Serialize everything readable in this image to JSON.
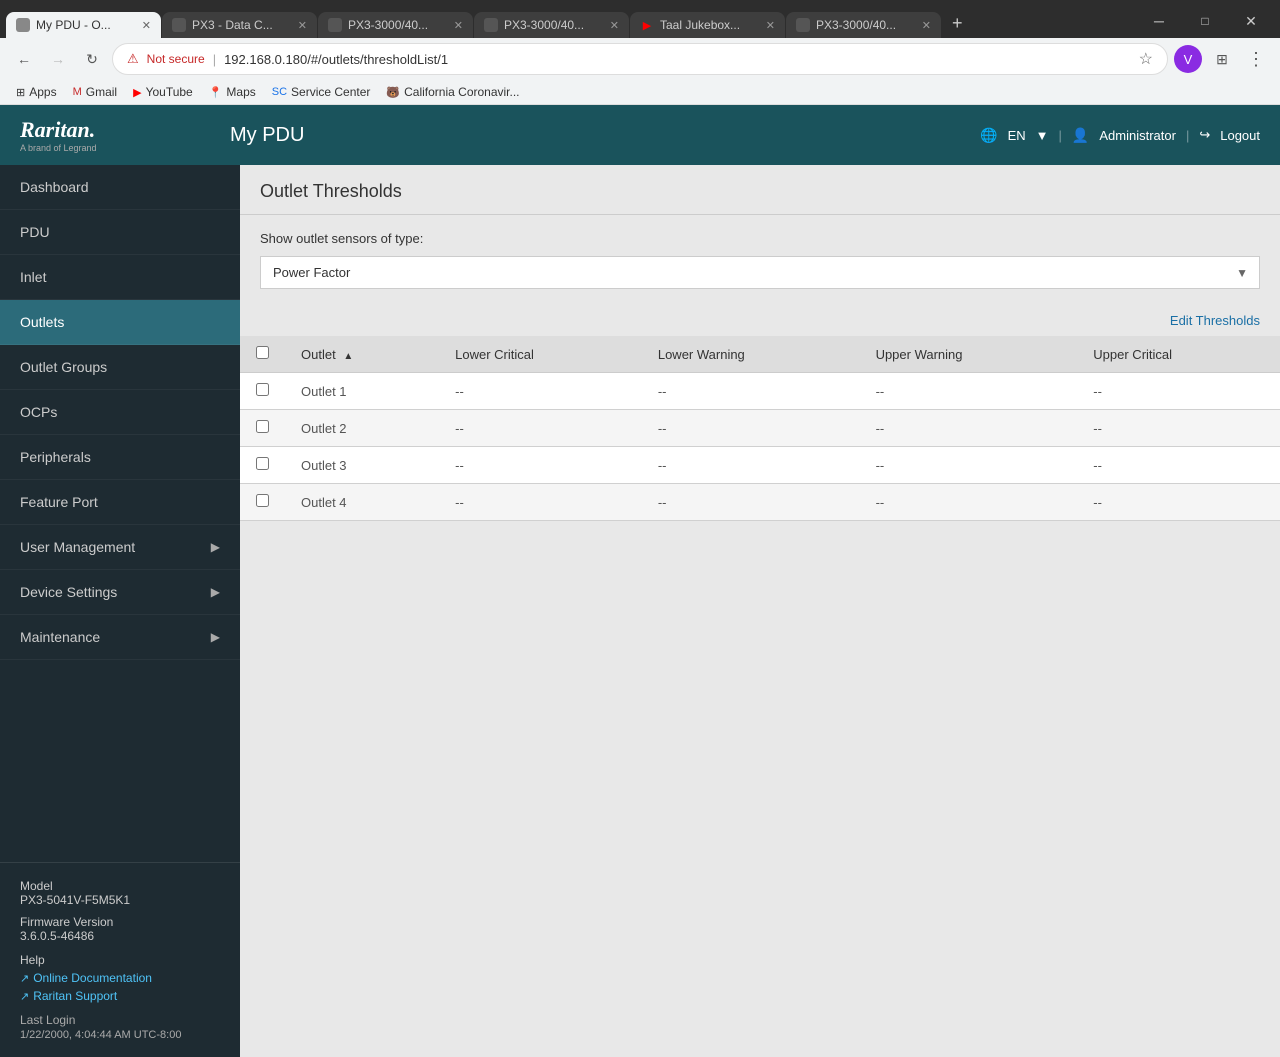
{
  "browser": {
    "tabs": [
      {
        "id": "tab1",
        "title": "My PDU - O...",
        "icon": "pdu",
        "active": true
      },
      {
        "id": "tab2",
        "title": "PX3 - Data C...",
        "icon": "px3",
        "active": false
      },
      {
        "id": "tab3",
        "title": "PX3-3000/40...",
        "icon": "px3",
        "active": false
      },
      {
        "id": "tab4",
        "title": "PX3-3000/40...",
        "icon": "px3",
        "active": false
      },
      {
        "id": "tab5",
        "title": "Taal Jukebox...",
        "icon": "yt",
        "active": false
      },
      {
        "id": "tab6",
        "title": "PX3-3000/40...",
        "icon": "px3",
        "active": false
      }
    ],
    "url": "192.168.0.180/#/outlets/thresholdList/1",
    "not_secure_label": "Not secure",
    "bookmarks": [
      {
        "label": "Apps",
        "icon": "grid"
      },
      {
        "label": "Gmail",
        "icon": "mail"
      },
      {
        "label": "YouTube",
        "icon": "yt"
      },
      {
        "label": "Maps",
        "icon": "maps"
      },
      {
        "label": "Service Center",
        "icon": "sc"
      },
      {
        "label": "California Coronavir...",
        "icon": "ca"
      }
    ]
  },
  "header": {
    "logo": "Raritan.",
    "logo_sub": "A brand of Legrand",
    "title": "My PDU",
    "lang": "EN",
    "user": "Administrator",
    "logout": "Logout"
  },
  "sidebar": {
    "items": [
      {
        "label": "Dashboard",
        "active": false,
        "has_arrow": false
      },
      {
        "label": "PDU",
        "active": false,
        "has_arrow": false
      },
      {
        "label": "Inlet",
        "active": false,
        "has_arrow": false
      },
      {
        "label": "Outlets",
        "active": true,
        "has_arrow": false
      },
      {
        "label": "Outlet Groups",
        "active": false,
        "has_arrow": false
      },
      {
        "label": "OCPs",
        "active": false,
        "has_arrow": false
      },
      {
        "label": "Peripherals",
        "active": false,
        "has_arrow": false
      },
      {
        "label": "Feature Port",
        "active": false,
        "has_arrow": false
      },
      {
        "label": "User Management",
        "active": false,
        "has_arrow": true
      },
      {
        "label": "Device Settings",
        "active": false,
        "has_arrow": true
      },
      {
        "label": "Maintenance",
        "active": false,
        "has_arrow": true
      }
    ],
    "model_label": "Model",
    "model_value": "PX3-5041V-F5M5K1",
    "firmware_label": "Firmware Version",
    "firmware_value": "3.6.0.5-46486",
    "help_label": "Help",
    "help_links": [
      {
        "label": "Online Documentation"
      },
      {
        "label": "Raritan Support"
      }
    ],
    "last_login_label": "Last Login",
    "last_login_value": "1/22/2000, 4:04:44 AM UTC-8:00"
  },
  "content": {
    "page_title": "Outlet Thresholds",
    "filter_label": "Show outlet sensors of type:",
    "filter_value": "Power Factor",
    "edit_link": "Edit Thresholds",
    "table": {
      "columns": [
        {
          "label": "Outlet",
          "sortable": true
        },
        {
          "label": "Lower Critical",
          "sortable": false
        },
        {
          "label": "Lower Warning",
          "sortable": false
        },
        {
          "label": "Upper Warning",
          "sortable": false
        },
        {
          "label": "Upper Critical",
          "sortable": false
        }
      ],
      "rows": [
        {
          "outlet": "Outlet 1",
          "lower_critical": "--",
          "lower_warning": "--",
          "upper_warning": "--",
          "upper_critical": "--"
        },
        {
          "outlet": "Outlet 2",
          "lower_critical": "--",
          "lower_warning": "--",
          "upper_warning": "--",
          "upper_critical": "--"
        },
        {
          "outlet": "Outlet 3",
          "lower_critical": "--",
          "lower_warning": "--",
          "upper_warning": "--",
          "upper_critical": "--"
        },
        {
          "outlet": "Outlet 4",
          "lower_critical": "--",
          "lower_warning": "--",
          "upper_warning": "--",
          "upper_critical": "--"
        }
      ]
    }
  }
}
